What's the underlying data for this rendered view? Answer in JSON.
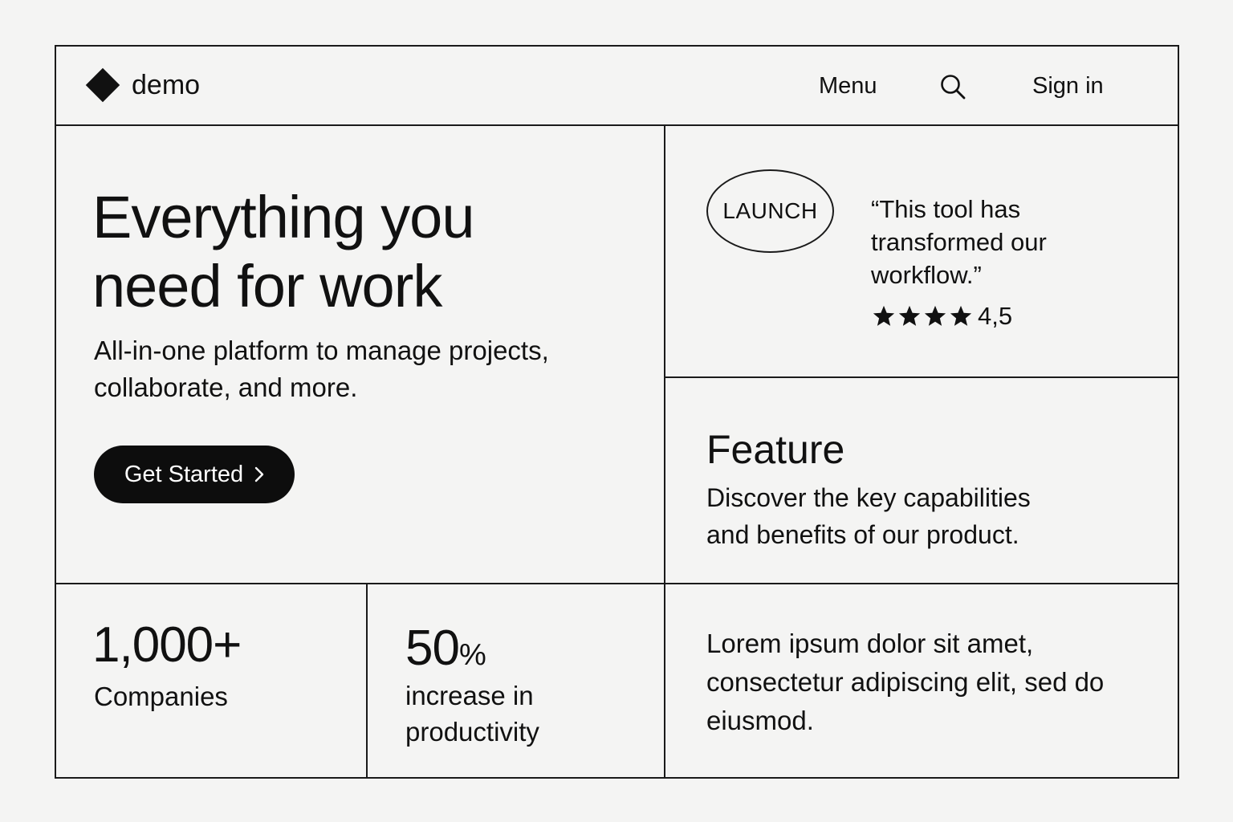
{
  "header": {
    "logo_text": "demo",
    "nav": {
      "menu_label": "Menu",
      "search_icon": "search-icon",
      "signin_label": "Sign in"
    }
  },
  "hero": {
    "title": "Everything you\nneed for work",
    "subtitle": "All-in-one platform to manage projects, collaborate, and more.",
    "cta_label": "Get Started",
    "cta_icon": "chevron-right-icon"
  },
  "testimonial": {
    "badge": "LAUNCH",
    "quote": "“This tool has transformed our workflow.”",
    "stars": 4,
    "rating": "4,5"
  },
  "feature": {
    "title": "Feature",
    "description": "Discover the key capabilities and benefits of our product."
  },
  "stats": [
    {
      "value": "1,000+",
      "label": "Companies"
    },
    {
      "value": "50",
      "unit": "%",
      "label": "increase in productivity"
    }
  ],
  "lorem": "Lorem ipsum dolor sit amet, consectetur adipiscing elit,  sed do eiusmod.",
  "colors": {
    "background": "#f4f4f3",
    "ink": "#111111",
    "button": "#0d0d0d",
    "button_text": "#ffffff"
  }
}
